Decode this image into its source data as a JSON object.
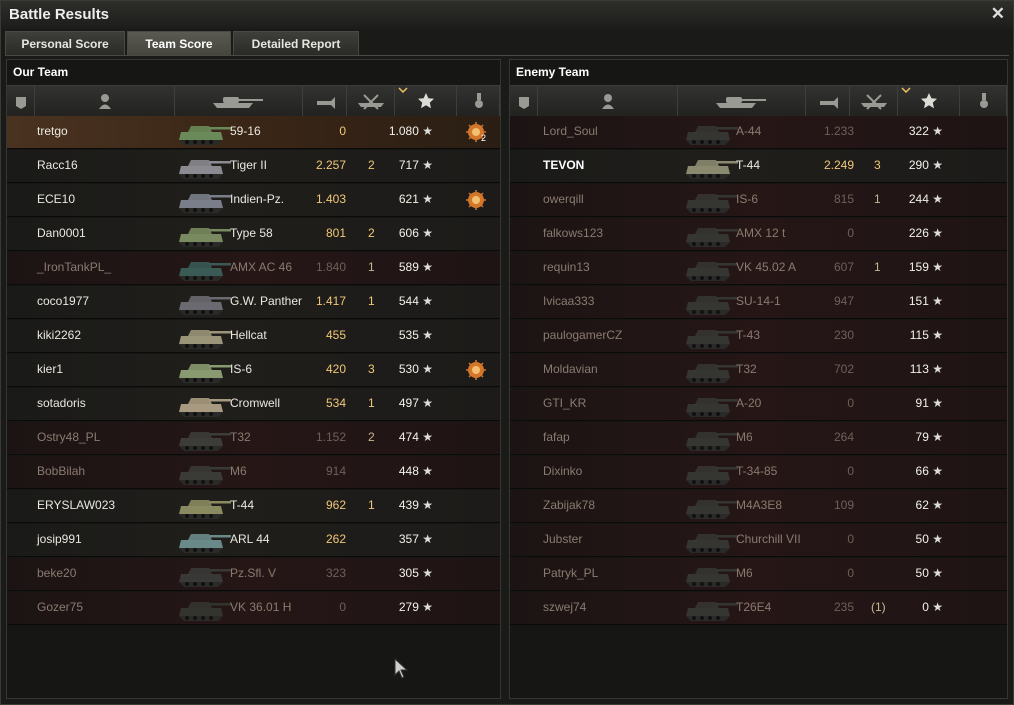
{
  "window": {
    "title": "Battle Results",
    "close_icon": "close-icon"
  },
  "tabs": [
    {
      "label": "Personal Score",
      "active": false
    },
    {
      "label": "Team Score",
      "active": true
    },
    {
      "label": "Detailed Report",
      "active": false
    }
  ],
  "columns": [
    "rank-icon",
    "player-icon",
    "vehicle-icon",
    "damage-icon",
    "kills-icon",
    "experience-icon",
    "medal-icon"
  ],
  "our_team": {
    "title": "Our Team",
    "rows": [
      {
        "name": "tretgo",
        "vehicle": "59-16",
        "damage": "0",
        "kills": "",
        "xp": "1.080",
        "medal": "2",
        "style": "hl"
      },
      {
        "name": "Racc16",
        "vehicle": "Tiger II",
        "damage": "2.257",
        "kills": "2",
        "xp": "717",
        "medal": "",
        "style": ""
      },
      {
        "name": "ECE10",
        "vehicle": "Indien-Pz.",
        "damage": "1.403",
        "kills": "",
        "xp": "621",
        "medal": "1",
        "style": ""
      },
      {
        "name": "Dan0001",
        "vehicle": "Type 58",
        "damage": "801",
        "kills": "2",
        "xp": "606",
        "medal": "",
        "style": ""
      },
      {
        "name": "_IronTankPL_",
        "vehicle": "AMX AC 46",
        "damage": "1.840",
        "kills": "1",
        "xp": "589",
        "medal": "",
        "style": "dim"
      },
      {
        "name": "coco1977",
        "vehicle": "G.W. Panther",
        "damage": "1.417",
        "kills": "1",
        "xp": "544",
        "medal": "",
        "style": ""
      },
      {
        "name": "kiki2262",
        "vehicle": "Hellcat",
        "damage": "455",
        "kills": "",
        "xp": "535",
        "medal": "",
        "style": ""
      },
      {
        "name": "kier1",
        "vehicle": "IS-6",
        "damage": "420",
        "kills": "3",
        "xp": "530",
        "medal": "1",
        "style": ""
      },
      {
        "name": "sotadoris",
        "vehicle": "Cromwell",
        "damage": "534",
        "kills": "1",
        "xp": "497",
        "medal": "",
        "style": ""
      },
      {
        "name": "Ostry48_PL",
        "vehicle": "T32",
        "damage": "1.152",
        "kills": "2",
        "xp": "474",
        "medal": "",
        "style": "dim"
      },
      {
        "name": "BobBilah",
        "vehicle": "M6",
        "damage": "914",
        "kills": "",
        "xp": "448",
        "medal": "",
        "style": "dim"
      },
      {
        "name": "ERYSLAW023",
        "vehicle": "T-44",
        "damage": "962",
        "kills": "1",
        "xp": "439",
        "medal": "",
        "style": ""
      },
      {
        "name": "josip991",
        "vehicle": "ARL 44",
        "damage": "262",
        "kills": "",
        "xp": "357",
        "medal": "",
        "style": ""
      },
      {
        "name": "beke20",
        "vehicle": "Pz.Sfl. V",
        "damage": "323",
        "kills": "",
        "xp": "305",
        "medal": "",
        "style": "dim"
      },
      {
        "name": "Gozer75",
        "vehicle": "VK 36.01 H",
        "damage": "0",
        "kills": "",
        "xp": "279",
        "medal": "",
        "style": "dim"
      }
    ]
  },
  "enemy_team": {
    "title": "Enemy Team",
    "rows": [
      {
        "name": "Lord_Soul",
        "vehicle": "A-44",
        "damage": "1.233",
        "kills": "",
        "xp": "322",
        "style": "dim"
      },
      {
        "name": "TEVON",
        "vehicle": "T-44",
        "damage": "2.249",
        "kills": "3",
        "xp": "290",
        "style": "bold"
      },
      {
        "name": "owerqill",
        "vehicle": "IS-6",
        "damage": "815",
        "kills": "1",
        "xp": "244",
        "style": "dim"
      },
      {
        "name": "falkows123",
        "vehicle": "AMX 12 t",
        "damage": "0",
        "kills": "",
        "xp": "226",
        "style": "dim"
      },
      {
        "name": "requin13",
        "vehicle": "VK 45.02 A",
        "damage": "607",
        "kills": "1",
        "xp": "159",
        "style": "dim"
      },
      {
        "name": "Ivicaa333",
        "vehicle": "SU-14-1",
        "damage": "947",
        "kills": "",
        "xp": "151",
        "style": "dim"
      },
      {
        "name": "paulogamerCZ",
        "vehicle": "T-43",
        "damage": "230",
        "kills": "",
        "xp": "115",
        "style": "dim"
      },
      {
        "name": "Moldavian",
        "vehicle": "T32",
        "damage": "702",
        "kills": "",
        "xp": "113",
        "style": "dim"
      },
      {
        "name": "GTI_KR",
        "vehicle": "A-20",
        "damage": "0",
        "kills": "",
        "xp": "91",
        "style": "dim"
      },
      {
        "name": "fafap",
        "vehicle": "M6",
        "damage": "264",
        "kills": "",
        "xp": "79",
        "style": "dim"
      },
      {
        "name": "Dixinko",
        "vehicle": "T-34-85",
        "damage": "0",
        "kills": "",
        "xp": "66",
        "style": "dim"
      },
      {
        "name": "Zabijak78",
        "vehicle": "M4A3E8",
        "damage": "109",
        "kills": "",
        "xp": "62",
        "style": "dim"
      },
      {
        "name": "Jubster",
        "vehicle": "Churchill VII",
        "damage": "0",
        "kills": "",
        "xp": "50",
        "style": "dim"
      },
      {
        "name": "Patryk_PL",
        "vehicle": "M6",
        "damage": "0",
        "kills": "",
        "xp": "50",
        "style": "dim"
      },
      {
        "name": "szwej74",
        "vehicle": "T26E4",
        "damage": "235",
        "kills": "(1)",
        "xp": "0",
        "style": "dim"
      }
    ]
  },
  "colors": {
    "highlight": "#4a3220",
    "damage": "#f0c878",
    "medal": "#d4762a"
  }
}
